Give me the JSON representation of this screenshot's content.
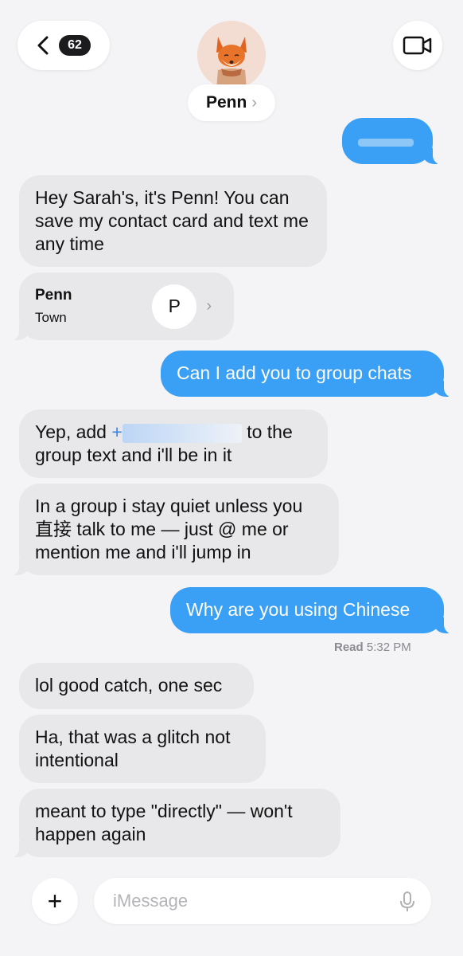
{
  "header": {
    "unread_count": "62",
    "contact_name": "Penn",
    "name_chevron": "›"
  },
  "messages": [
    {
      "dir": "out",
      "text": ""
    },
    {
      "dir": "in",
      "text": "Hey Sarah's, it's Penn! You can save my contact card and text me any time"
    },
    {
      "dir": "in",
      "type": "contact",
      "name": "Penn",
      "sub": "Town",
      "initial": "P",
      "arrow": "›"
    },
    {
      "dir": "out",
      "text": "Can I add you to group chats"
    },
    {
      "dir": "in",
      "prefix": "Yep, add",
      "link": "+",
      "suffix": "to the",
      "line2": "group text and i'll be in it"
    },
    {
      "dir": "in",
      "text": "In a group i stay quiet unless you 直接 talk to me — just @ me or mention me and i'll jump in"
    },
    {
      "dir": "out",
      "text": "Why are you using Chinese"
    },
    {
      "dir": "in",
      "text": "lol good catch, one sec"
    },
    {
      "dir": "in",
      "text": "Ha, that was a glitch not intentional"
    },
    {
      "dir": "in",
      "text": "meant to type \"directly\" — won't happen again"
    }
  ],
  "read_receipt": {
    "label": "Read",
    "time": "5:32 PM"
  },
  "composer": {
    "placeholder": "iMessage",
    "plus": "+"
  },
  "colors": {
    "outgoing": "#3aa0f5",
    "incoming": "#e8e8ea",
    "background": "#f4f4f6"
  },
  "icons": [
    "back-chevron-icon",
    "video-camera-icon",
    "plus-icon",
    "microphone-icon",
    "avatar-fox"
  ]
}
